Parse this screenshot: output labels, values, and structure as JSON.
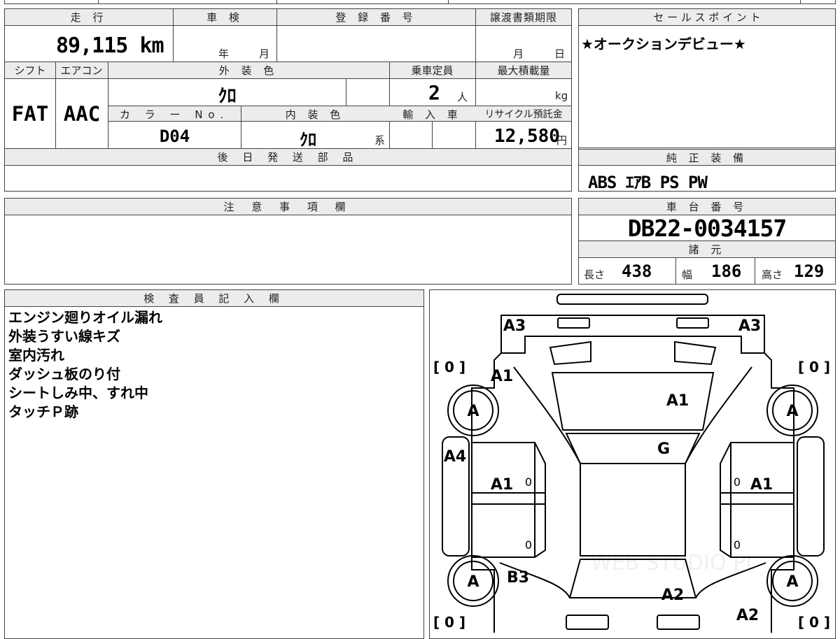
{
  "mileage": {
    "label": "走 行",
    "value": "89,115",
    "unit": "km"
  },
  "inspection": {
    "label": "車 検",
    "year_unit": "年",
    "month_unit": "月"
  },
  "registration": {
    "label": "登 録 番 号",
    "value": ""
  },
  "transfer_deadline": {
    "label": "譲渡書類期限",
    "month_unit": "月",
    "day_unit": "日"
  },
  "sales_point": {
    "label": "セ ー ル ス ポ イ ン ト",
    "value": "★オークションデビュー★"
  },
  "shift": {
    "label": "シフト",
    "value": "FAT"
  },
  "aircon": {
    "label": "エアコン",
    "value": "AAC"
  },
  "exterior_color": {
    "label": "外 装 色",
    "value": "ｸﾛ"
  },
  "capacity": {
    "label": "乗車定員",
    "value": "2",
    "unit": "人"
  },
  "max_load": {
    "label": "最大積載量",
    "value": "",
    "unit": "kg"
  },
  "color_no": {
    "label": "カ ラ ー No.",
    "value": "D04"
  },
  "interior_color": {
    "label": "内 装 色",
    "value": "ｸﾛ",
    "suffix": "系"
  },
  "import": {
    "label": "輸 入 車",
    "value": ""
  },
  "recycle_fee": {
    "label": "リサイクル預託金",
    "value": "12,580",
    "unit": "円"
  },
  "later_parts": {
    "label": "後 日 発 送 部 品",
    "value": ""
  },
  "genuine_equipment": {
    "label": "純 正 装 備",
    "value": "ABS ｴｱB PS PW"
  },
  "notes": {
    "label": "注 意 事 項 欄",
    "value": ""
  },
  "chassis_no": {
    "label": "車 台 番 号",
    "value": "DB22-0034157"
  },
  "specs": {
    "label": "諸 元",
    "length_label": "長さ",
    "length": "438",
    "width_label": "幅",
    "width": "186",
    "height_label": "高さ",
    "height": "129"
  },
  "inspector": {
    "label": "検 査 員 記 入 欄",
    "remarks": [
      "エンジン廻りオイル漏れ",
      "外装うすい線キズ",
      "室内汚れ",
      "ダッシュ板のり付",
      "シートしみ中、すれ中",
      "タッチＰ跡"
    ]
  },
  "diagram": {
    "tire_grade": "A",
    "tread_fl": "[ 0 ]",
    "tread_fr": "[ 0 ]",
    "tread_rl": "[ 0 ]",
    "tread_rr": "[ 0 ]",
    "front_left": "A3",
    "front_right": "A3",
    "fender_left": "A1",
    "hood": "A1",
    "windshield": "G",
    "pillar_left": "A4",
    "door_left": "A1",
    "door_right": "A1",
    "door_marks": [
      "0",
      "0",
      "0",
      "0"
    ],
    "rear_fender_left": "B3",
    "roof_rear": "A2",
    "rear_right": "A2",
    "watermark": "WEB STUDIO PI"
  }
}
